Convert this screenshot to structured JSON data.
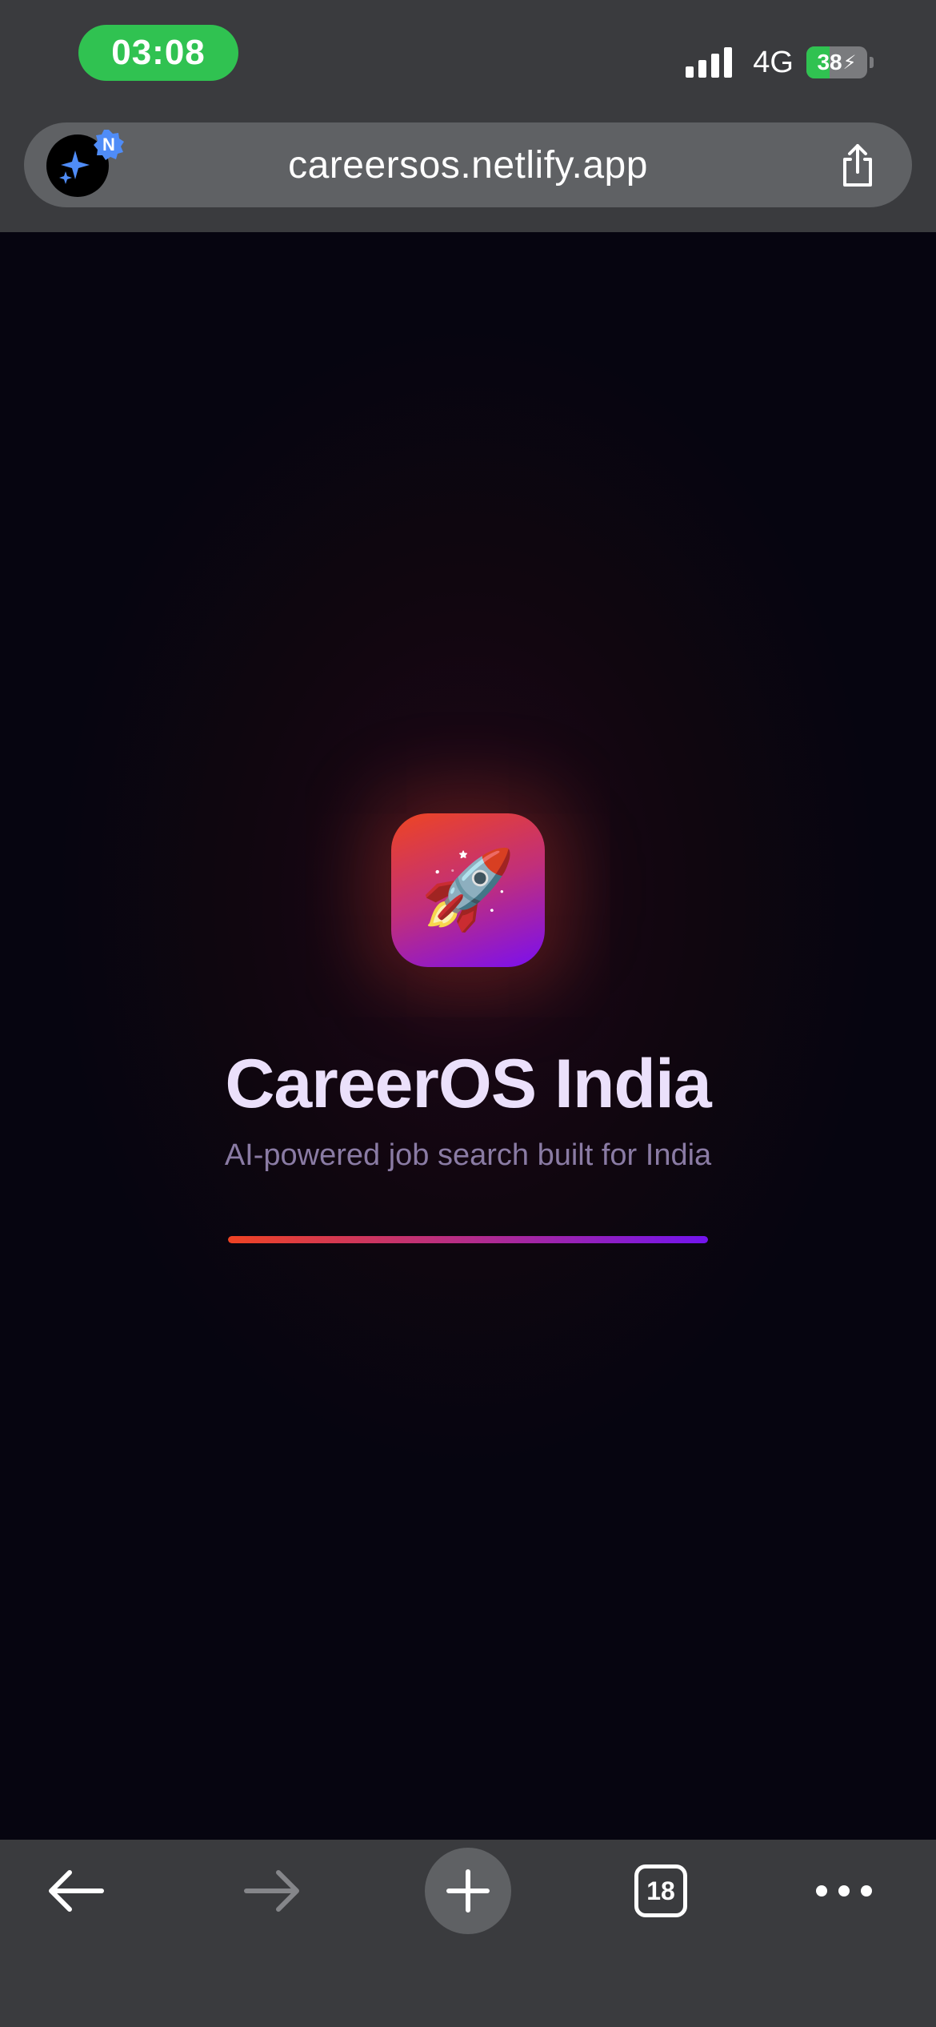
{
  "status_bar": {
    "time": "03:08",
    "network": "4G",
    "battery": {
      "level": "38",
      "fraction": 0.38
    }
  },
  "browser": {
    "url": "careersos.netlify.app",
    "site_badge": "N",
    "tab_count": "18"
  },
  "splash": {
    "icon": "rocket-emoji",
    "icon_glyph": "🚀",
    "title": "CareerOS India",
    "subtitle": "AI-powered job search built for India",
    "progress": 1.0
  },
  "colors": {
    "time_pill": "#30c251",
    "chrome": "#3a3b3e",
    "url_bar": "#5f6164",
    "page_bg": "#060510",
    "title": "#ebe0fb",
    "subtitle": "#8a7ba4",
    "gradient_start": "#ef4323",
    "gradient_end": "#7214ef"
  },
  "toolbar_icons": [
    "back-arrow-icon",
    "forward-arrow-icon",
    "plus-icon",
    "tabs-icon",
    "more-dots-icon"
  ]
}
